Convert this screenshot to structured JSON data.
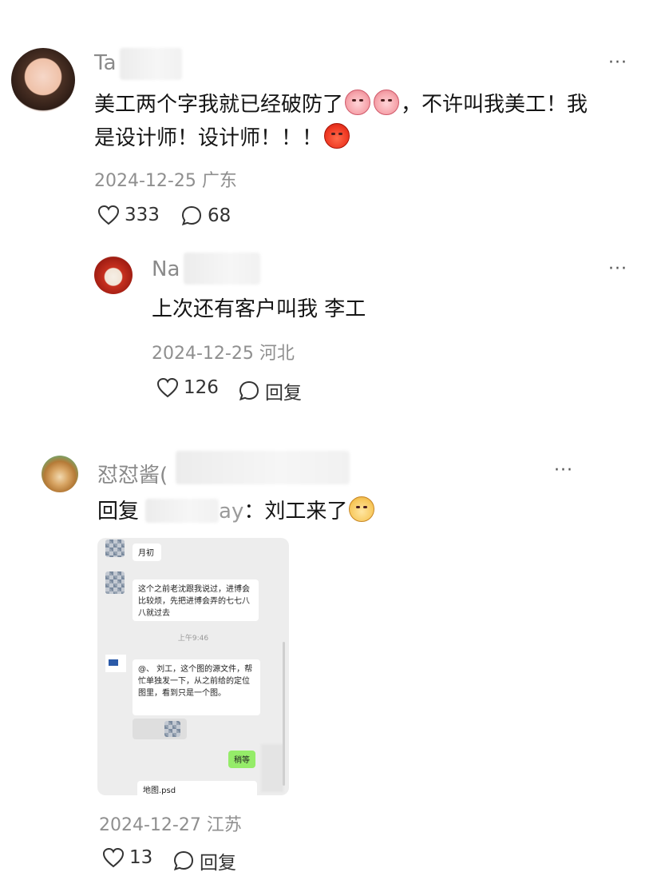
{
  "comments": [
    {
      "name": "Ta",
      "text_a": "美工两个字我就已经破防了",
      "text_b": "，不许叫我美工！我",
      "text_c": "是设计师！设计师！！！",
      "meta": "2024-12-25 广东",
      "likes": "333",
      "replies": "68",
      "more": "···",
      "icons": [
        "laughing-crying-emoji",
        "laughing-crying-emoji",
        "angry-devil-emoji"
      ]
    },
    {
      "name": "Na",
      "text": "上次还有客户叫我 李工",
      "meta": "2024-12-25 河北",
      "likes": "126",
      "reply_label": "回复",
      "more": "···"
    },
    {
      "name": "怼怼酱(",
      "reply_prefix": "回复",
      "reply_target": "ay",
      "reply_text": "：刘工来了",
      "meta": "2024-12-27 江苏",
      "likes": "13",
      "reply_label": "回复",
      "more": "···",
      "icons": [
        "smirk-emoji"
      ]
    }
  ],
  "chat_image": {
    "msg1": "月初",
    "msg2": "这个之前老沈跟我说过，进博会比较烦，先把进博会弄的七七八八就过去",
    "time": "上午9:46",
    "msg3": "@、 刘工，这个图的源文件，帮忙单独发一下，从之前给的定位图里，看到只是一个图。",
    "msg4": "稍等",
    "file": "地图.psd"
  },
  "colors": {
    "meta": "#8f8f8f",
    "chat_bg": "#ededed",
    "green_bubble": "#95ec69"
  }
}
